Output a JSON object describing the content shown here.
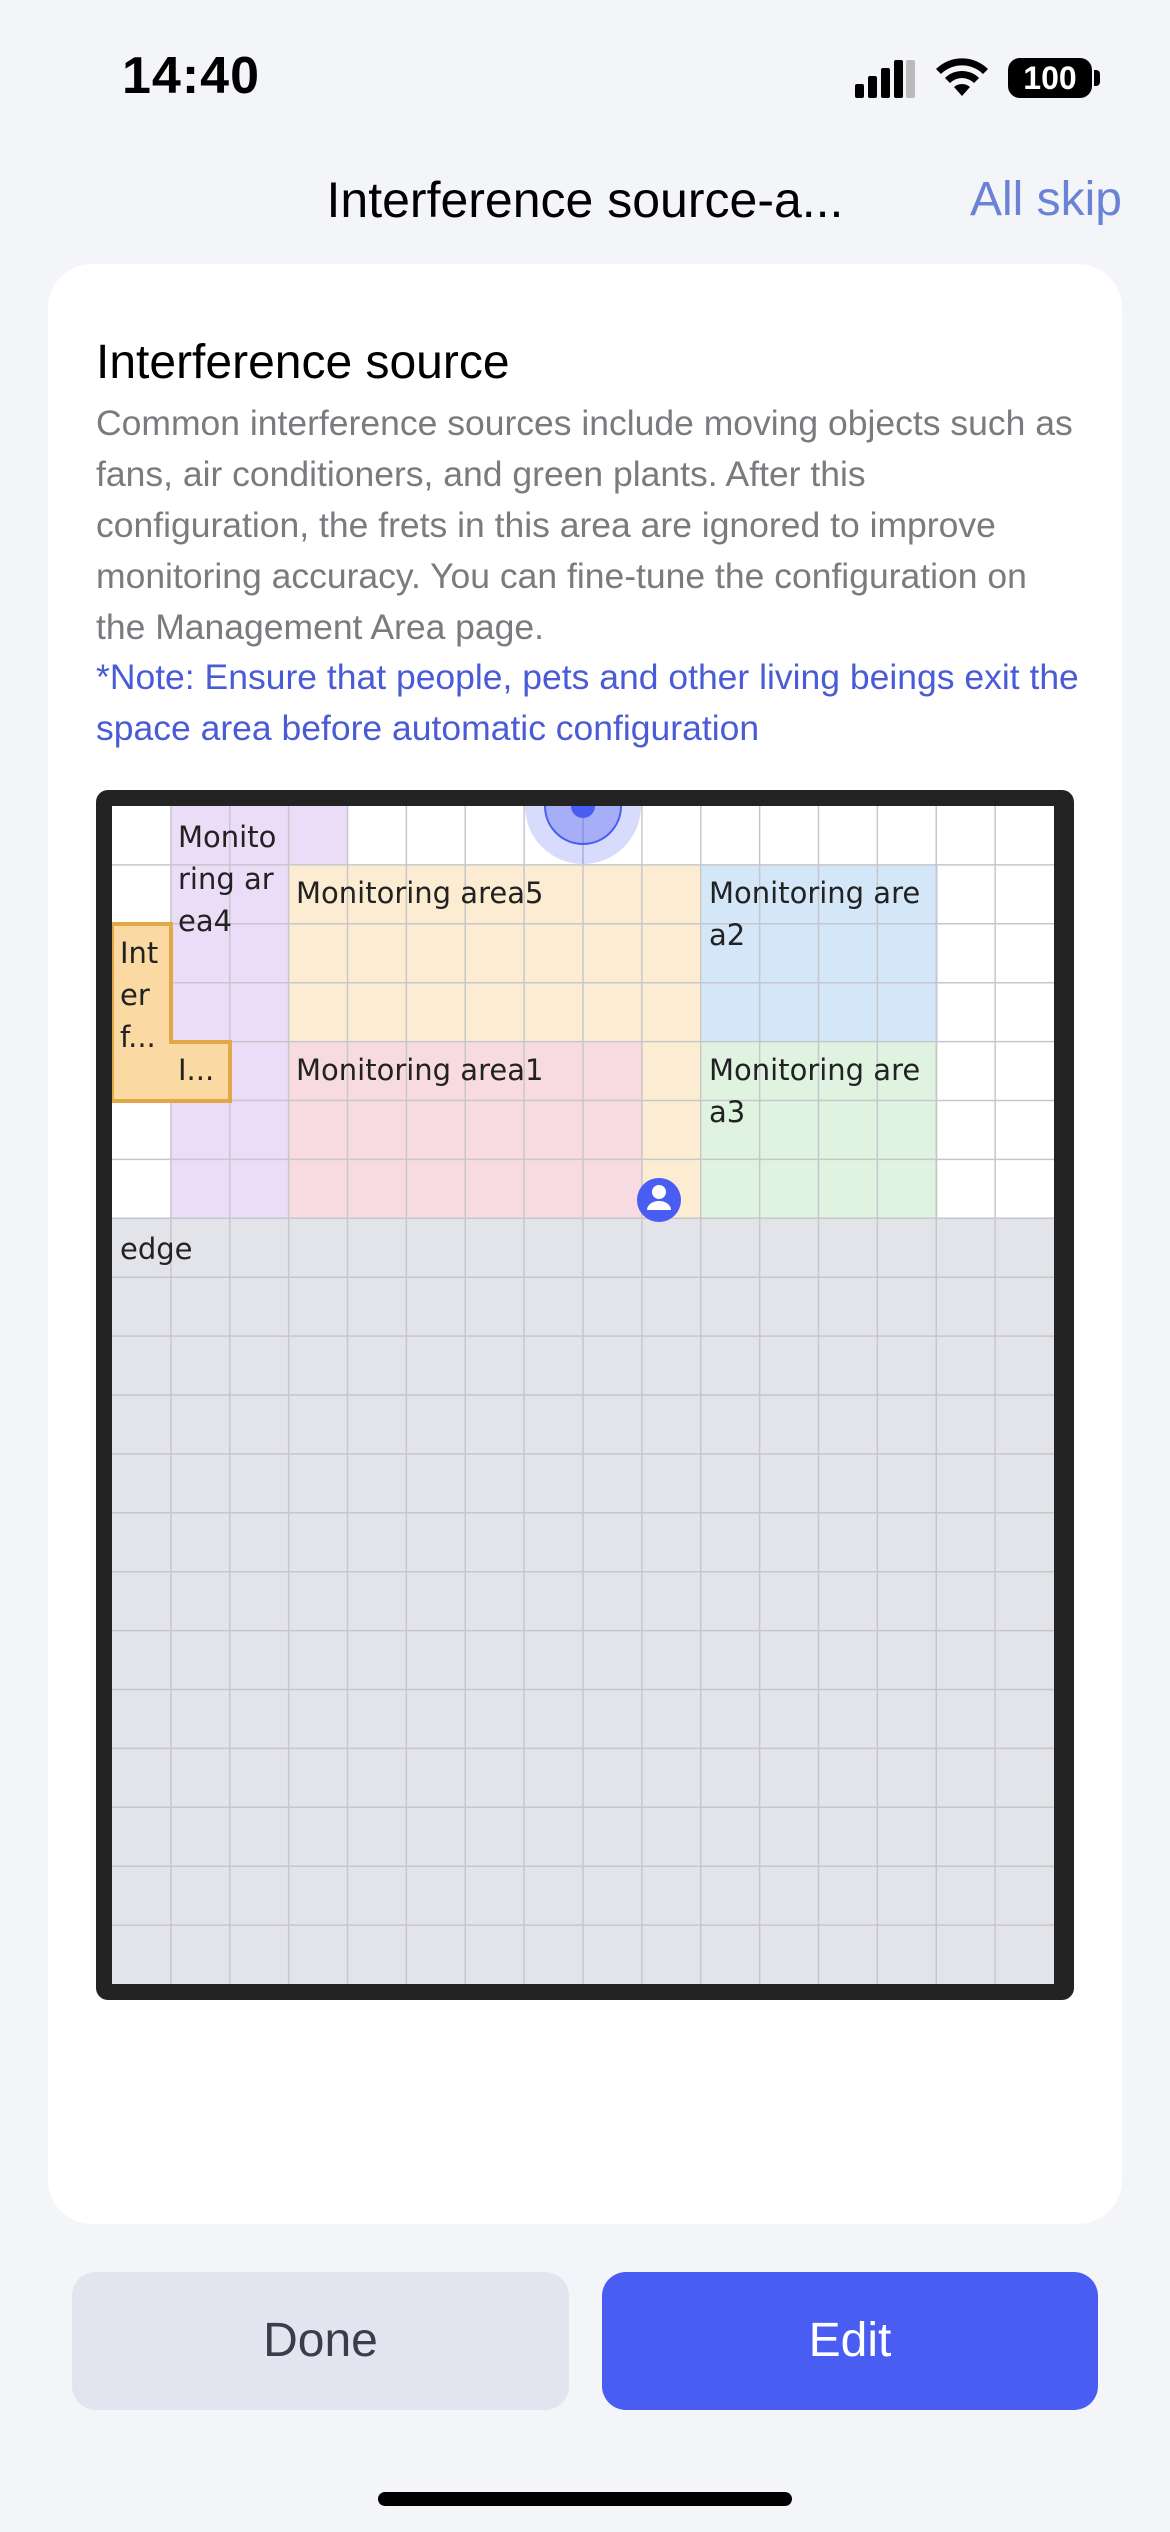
{
  "status_bar": {
    "time": "14:40",
    "battery": "100"
  },
  "header": {
    "title": "Interference source-a...",
    "skip_label": "All skip"
  },
  "card": {
    "title": "Interference source",
    "description": "Common interference sources include moving objects such as fans, air conditioners, and green plants. After this configuration, the frets in this area are ignored to improve monitoring accuracy. You can fine-tune the configuration on the Management Area page.",
    "note": "*Note: Ensure that people, pets and other living beings exit the space area before automatic configuration"
  },
  "map": {
    "zones": {
      "area4": "Monitoring area4",
      "area5": "Monitoring area5",
      "area2": "Monitoring area2",
      "area1": "Monitoring area1",
      "area3": "Monitoring area3",
      "interference_1": "Interf...",
      "interference_2": "I...",
      "edge": "edge"
    },
    "colors": {
      "area4": "#ebdcf7",
      "area5": "#fcedd2",
      "area2": "#d3e7f8",
      "area1": "#f8dbe1",
      "area3": "#dff3e0",
      "interference": "#fad9a2",
      "interference_border": "#e2a848",
      "edge": "#e3e4e9",
      "sensor": "#4a5df2"
    }
  },
  "actions": {
    "done_label": "Done",
    "edit_label": "Edit"
  }
}
